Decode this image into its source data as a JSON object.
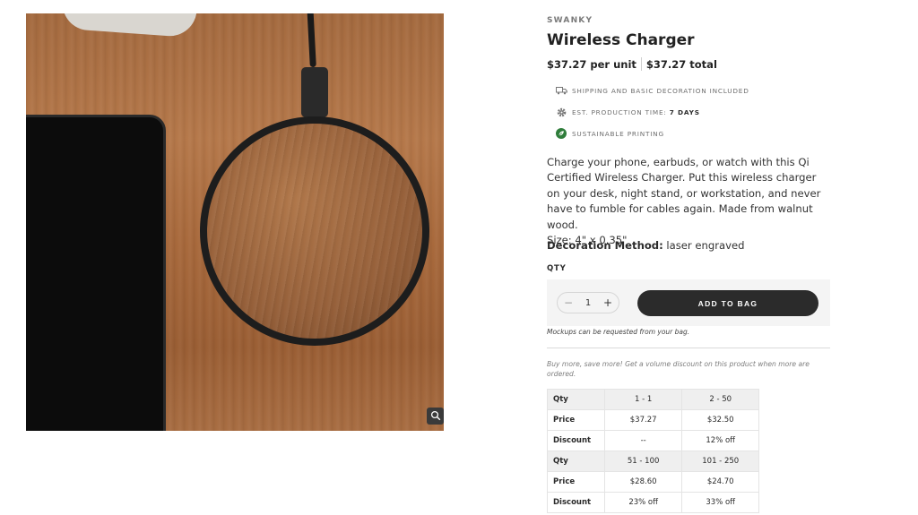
{
  "brand": "SWANKY",
  "product": {
    "title": "Wireless Charger",
    "price_unit": "$37.27 per unit",
    "price_total": "$37.27 total",
    "description": "Charge your phone, earbuds, or watch with this Qi Certified Wireless Charger. Put this wireless charger on your desk, night stand, or workstation, and never have to fumble for cables again. Made from walnut wood.",
    "size": "Size: 4\" x 0.35\"",
    "decoration_label": "Decoration Method:",
    "decoration_value": "laser engraved"
  },
  "features": {
    "shipping": "SHIPPING AND BASIC DECORATION INCLUDED",
    "production_label": "EST. PRODUCTION TIME:",
    "production_value": "7 DAYS",
    "sustainable": "SUSTAINABLE PRINTING"
  },
  "purchase": {
    "qty_label": "QTY",
    "minus": "−",
    "qty_value": "1",
    "plus": "+",
    "add_to_bag": "ADD TO BAG",
    "mockups_note": "Mockups can be requested from your bag."
  },
  "volume": {
    "note": "Buy more, save more! Get a volume discount on this product when more are ordered.",
    "rows": [
      {
        "label": "Qty",
        "c1": "1 - 1",
        "c2": "2 - 50"
      },
      {
        "label": "Price",
        "c1": "$37.27",
        "c2": "$32.50"
      },
      {
        "label": "Discount",
        "c1": "--",
        "c2": "12% off"
      },
      {
        "label": "Qty",
        "c1": "51 - 100",
        "c2": "101 - 250"
      },
      {
        "label": "Price",
        "c1": "$28.60",
        "c2": "$24.70"
      },
      {
        "label": "Discount",
        "c1": "23% off",
        "c2": "33% off"
      }
    ]
  },
  "icons": {
    "zoom": "magnifier-icon",
    "shipping": "truck-icon",
    "production": "gear-icon",
    "sustainable": "leaf-icon"
  },
  "colors": {
    "button": "#2b2b2b",
    "leaf": "#2f7d3b",
    "table_header": "#efefef"
  }
}
